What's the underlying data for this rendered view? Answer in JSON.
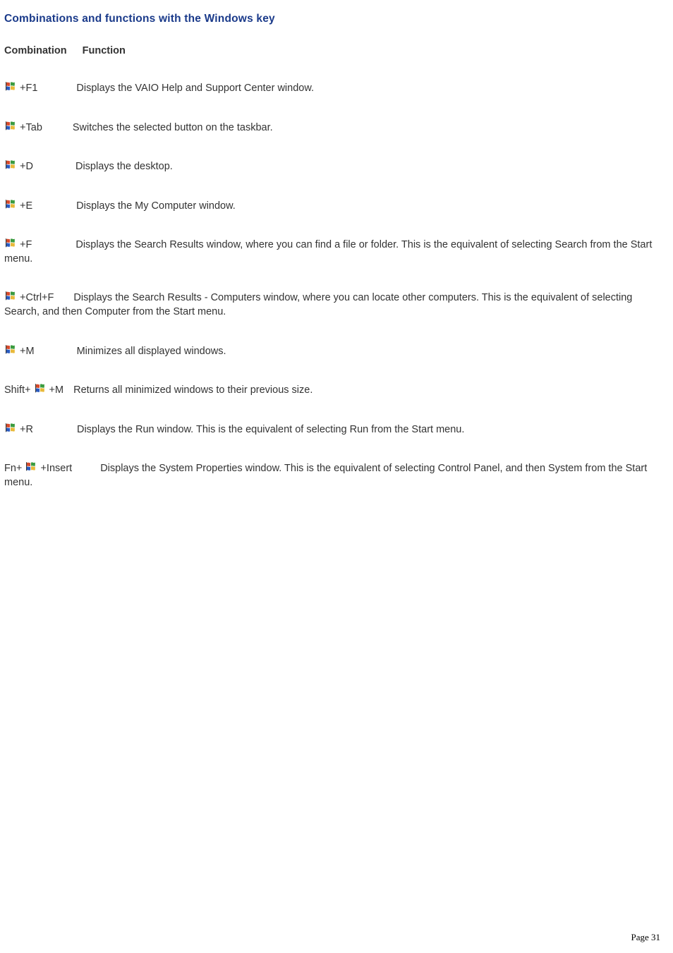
{
  "title": "Combinations and functions with the Windows key",
  "header": {
    "combo": "Combination",
    "func": "Function"
  },
  "rows": [
    {
      "pre": "",
      "iconAfterPre": true,
      "key": " +F1",
      "func": "Displays the VAIO Help and Support Center window.",
      "gap": 55
    },
    {
      "pre": "",
      "iconAfterPre": true,
      "key": " +Tab",
      "func": "Switches the selected button on the taskbar.",
      "gap": 43
    },
    {
      "pre": "",
      "iconAfterPre": true,
      "key": " +D",
      "func": "Displays the desktop.",
      "gap": 60
    },
    {
      "pre": "",
      "iconAfterPre": true,
      "key": " +E",
      "func": "Displays the My Computer window.",
      "gap": 62
    },
    {
      "pre": "",
      "iconAfterPre": true,
      "key": " +F",
      "func": "Displays the Search Results window, where you can find a file or folder. This is the equivalent of selecting Search from the Start menu.",
      "gap": 62,
      "wrap": true
    },
    {
      "pre": "",
      "iconAfterPre": true,
      "key": " +Ctrl+F",
      "func": "Displays the Search Results - Computers window, where you can locate other computers. This is the equivalent of selecting Search, and then Computer from the Start menu.",
      "gap": 28,
      "wrap": true
    },
    {
      "pre": "",
      "iconAfterPre": true,
      "key": " +M",
      "func": "Minimizes all displayed windows.",
      "gap": 60
    },
    {
      "pre": "Shift+ ",
      "iconAfterPre": true,
      "key": "  +M",
      "func": "Returns all minimized windows to their previous size.",
      "gap": 14
    },
    {
      "pre": "",
      "iconAfterPre": true,
      "key": " +R",
      "func": "Displays the Run window. This is the equivalent of selecting Run from the Start menu.",
      "gap": 62
    },
    {
      "pre": "Fn+ ",
      "iconAfterPre": true,
      "key": "  +Insert",
      "func": "Displays the System Properties window. This is the equivalent of selecting Control Panel, and then System from the Start menu.",
      "gap": 40,
      "wrap": true
    }
  ],
  "footer": "Page 31"
}
